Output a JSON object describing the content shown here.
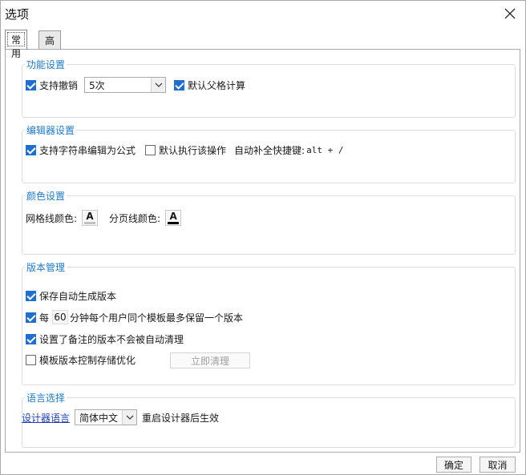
{
  "window": {
    "title": "选项"
  },
  "tabs": [
    {
      "label": "常用",
      "active": true
    },
    {
      "label": "高级",
      "active": false
    }
  ],
  "sections": {
    "function": {
      "title": "功能设置",
      "undo_label": "支持撤销",
      "undo_checked": true,
      "undo_select_value": "5次",
      "parent_calc_label": "默认父格计算",
      "parent_calc_checked": true
    },
    "editor": {
      "title": "编辑器设置",
      "string_formula_label": "支持字符串编辑为公式",
      "string_formula_checked": true,
      "default_exec_label": "默认执行该操作",
      "default_exec_checked": false,
      "autocomplete_label": "自动补全快捷键:",
      "autocomplete_shortcut": "alt + /"
    },
    "color": {
      "title": "颜色设置",
      "grid_label": "网格线颜色:",
      "grid_color": "#c0c0c0",
      "page_label": "分页线颜色:",
      "page_color": "#000000",
      "glyph": "A"
    },
    "version": {
      "title": "版本管理",
      "auto_version_label": "保存自动生成版本",
      "auto_version_checked": true,
      "every_prefix": "每",
      "every_minutes": "60",
      "every_suffix": "分钟每个用户同个模板最多保留一个版本",
      "every_checked": true,
      "remark_label": "设置了备注的版本不会被自动清理",
      "remark_checked": true,
      "optimize_label": "模板版本控制存储优化",
      "optimize_checked": false,
      "clean_button": "立即清理"
    },
    "language": {
      "title": "语言选择",
      "designer_lang_link": "设计器语言",
      "lang_value": "简体中文",
      "restart_note": "重启设计器后生效"
    }
  },
  "footer": {
    "ok_label": "确定",
    "cancel_label": "取消"
  },
  "colors": {
    "accent": "#1e6fd0",
    "section_title": "#1e7ac8",
    "link": "#1a3fb6"
  }
}
